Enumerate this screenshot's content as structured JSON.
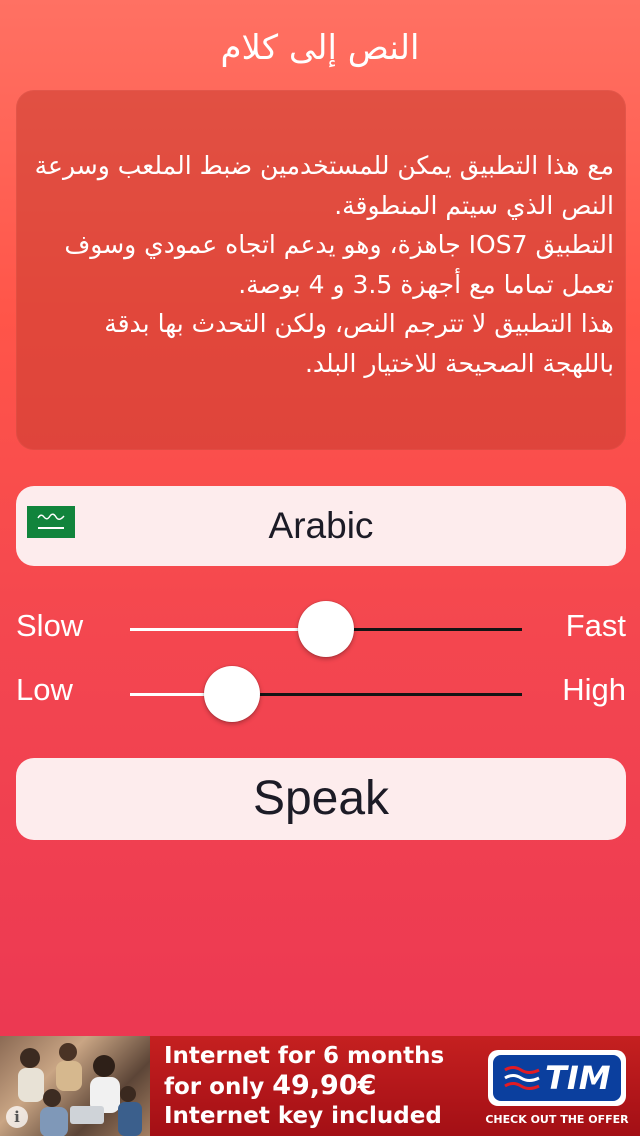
{
  "header": {
    "title": "النص إلى كلام"
  },
  "description": {
    "text": "مع هذا التطبيق يمكن للمستخدمين ضبط الملعب وسرعة النص الذي سيتم المنطوقة.\nالتطبيق IOS7 جاهزة، وهو يدعم اتجاه عمودي وسوف تعمل تماما مع أجهزة 3.5 و 4 بوصة.\nهذا التطبيق لا تترجم النص، ولكن التحدث بها بدقة باللهجة الصحيحة للاختيار البلد."
  },
  "language": {
    "selected": "Arabic",
    "flag_icon": "saudi-arabia-flag-icon"
  },
  "speed_slider": {
    "min_label": "Slow",
    "max_label": "Fast",
    "value": 0.5
  },
  "pitch_slider": {
    "min_label": "Low",
    "max_label": "High",
    "value": 0.26
  },
  "speak_button": {
    "label": "Speak"
  },
  "ad": {
    "line1": "Internet for 6 months",
    "line2_prefix": "for only ",
    "line2_price": "49,90€",
    "line3": "Internet key included",
    "brand": "TIM",
    "cta": "CHECK OUT THE OFFER",
    "info_icon": "info-icon"
  },
  "colors": {
    "background_top": "#ff7163",
    "background_bottom": "#ea3553",
    "card": "#fdeced",
    "ad_red": "#c52020",
    "tim_blue": "#0b3f9e"
  }
}
